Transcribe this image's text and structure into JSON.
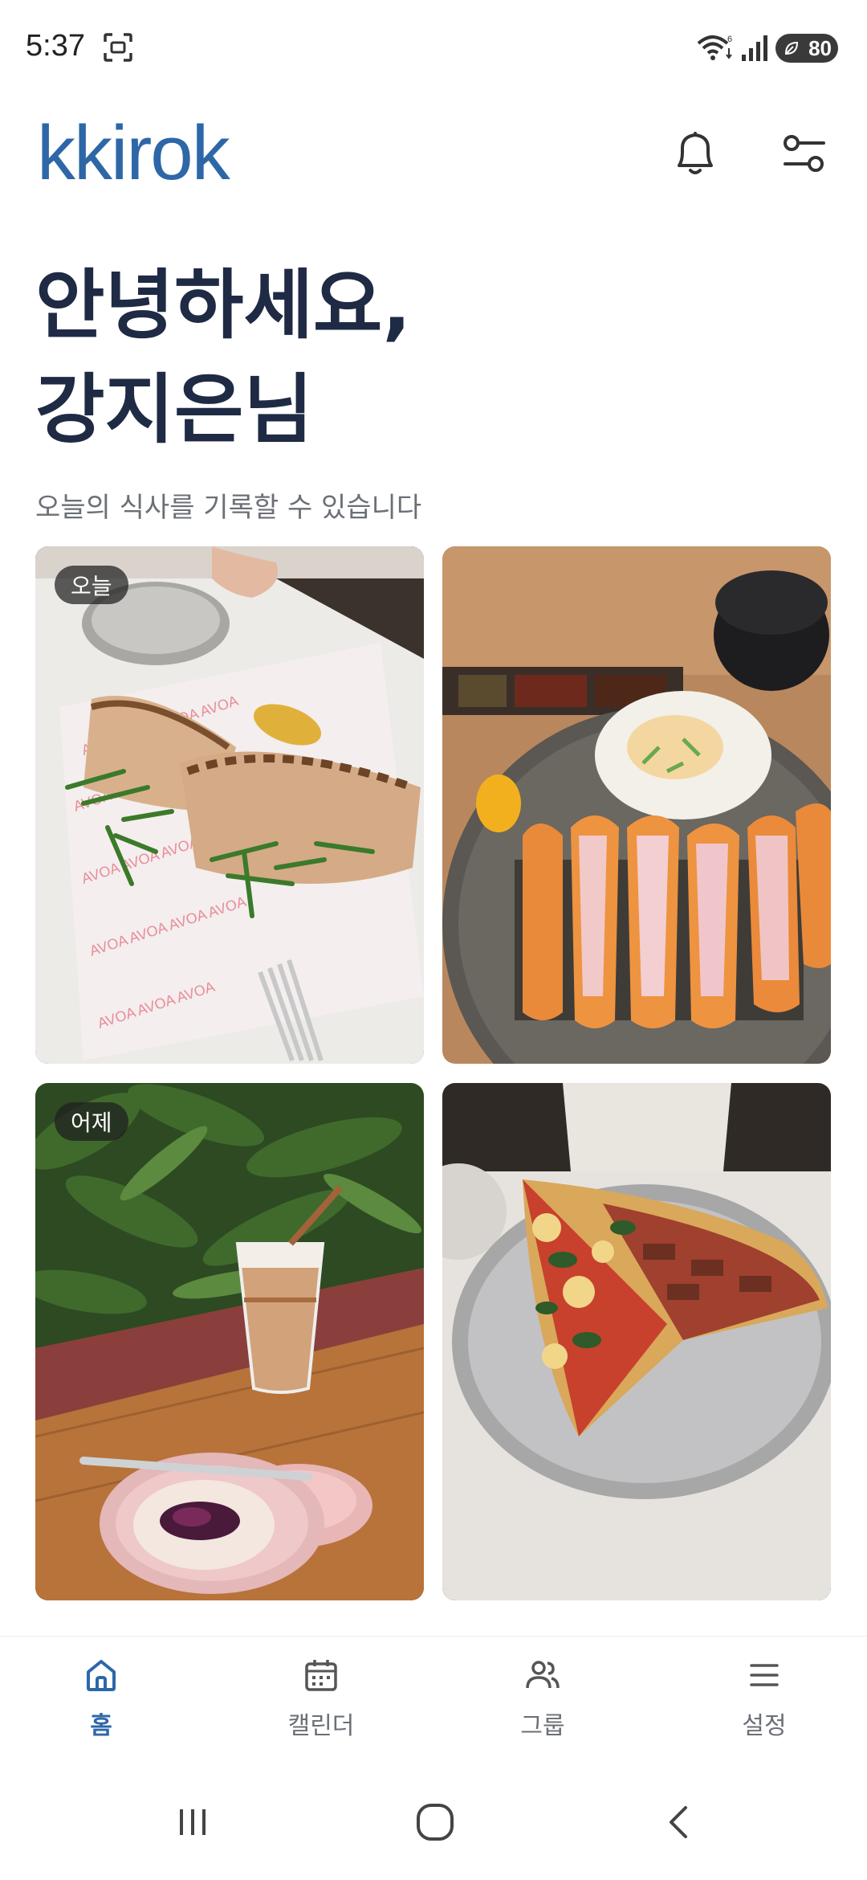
{
  "status_bar": {
    "time": "5:37",
    "battery_level": "80",
    "icons": [
      "screenshot-icon",
      "wifi-icon",
      "signal-icon",
      "battery-icon"
    ]
  },
  "header": {
    "logo": "kkirok",
    "icons": [
      "bell-icon",
      "filter-icon"
    ],
    "brand_color": "#2e67a8"
  },
  "greeting": {
    "line1": "안녕하세요,",
    "line2": "강지은님",
    "subtitle": "오늘의 식사를 기록할 수 있습니다"
  },
  "photos": [
    {
      "badge": "오늘",
      "image": "flatbread sandwich photo"
    },
    {
      "badge": "",
      "image": "pork cutlet photo"
    },
    {
      "badge": "어제",
      "image": "iced latte and berry tart photo"
    },
    {
      "badge": "",
      "image": "pizza slices photo"
    }
  ],
  "bottom_nav": {
    "items": [
      {
        "label": "홈",
        "icon": "home-icon",
        "active": true
      },
      {
        "label": "캘린더",
        "icon": "calendar-icon",
        "active": false
      },
      {
        "label": "그룹",
        "icon": "group-icon",
        "active": false
      },
      {
        "label": "설정",
        "icon": "menu-icon",
        "active": false
      }
    ]
  },
  "system_nav": {
    "icons": [
      "recents-icon",
      "home-circle-icon",
      "back-icon"
    ]
  }
}
